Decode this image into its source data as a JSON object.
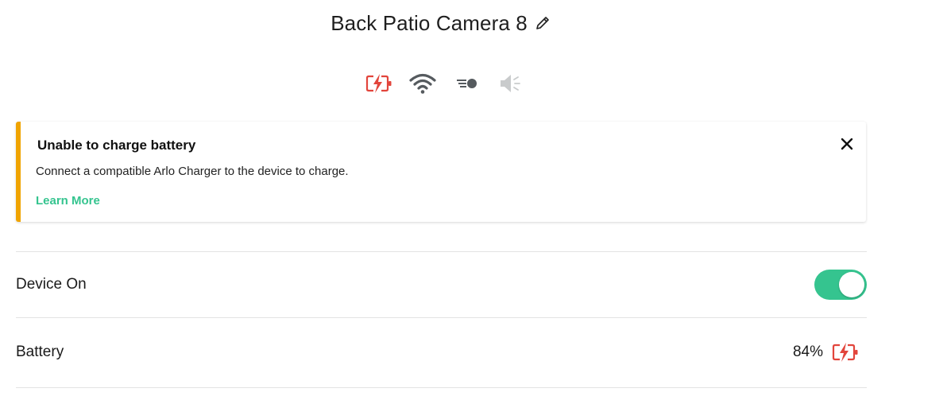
{
  "header": {
    "device_name": "Back Patio Camera 8",
    "edit_icon": "pencil-icon"
  },
  "status_icons": [
    {
      "name": "battery-charging-error-icon",
      "color": "#e2453c"
    },
    {
      "name": "wifi-icon",
      "color": "#555a5e"
    },
    {
      "name": "motion-icon",
      "color": "#555a5e"
    },
    {
      "name": "speaker-muted-icon",
      "color": "#c9cbcc"
    }
  ],
  "alert": {
    "title": "Unable to charge battery",
    "message": "Connect a compatible Arlo Charger to the device to charge.",
    "link_label": "Learn More",
    "accent_color": "#f0a400",
    "close_icon": "close-icon"
  },
  "settings": {
    "device_on": {
      "label": "Device On",
      "enabled": true
    },
    "battery": {
      "label": "Battery",
      "value": "84%",
      "icon": "battery-charging-error-icon"
    }
  },
  "colors": {
    "accent_green": "#35c48f",
    "warning": "#f0a400",
    "error": "#e2453c"
  }
}
